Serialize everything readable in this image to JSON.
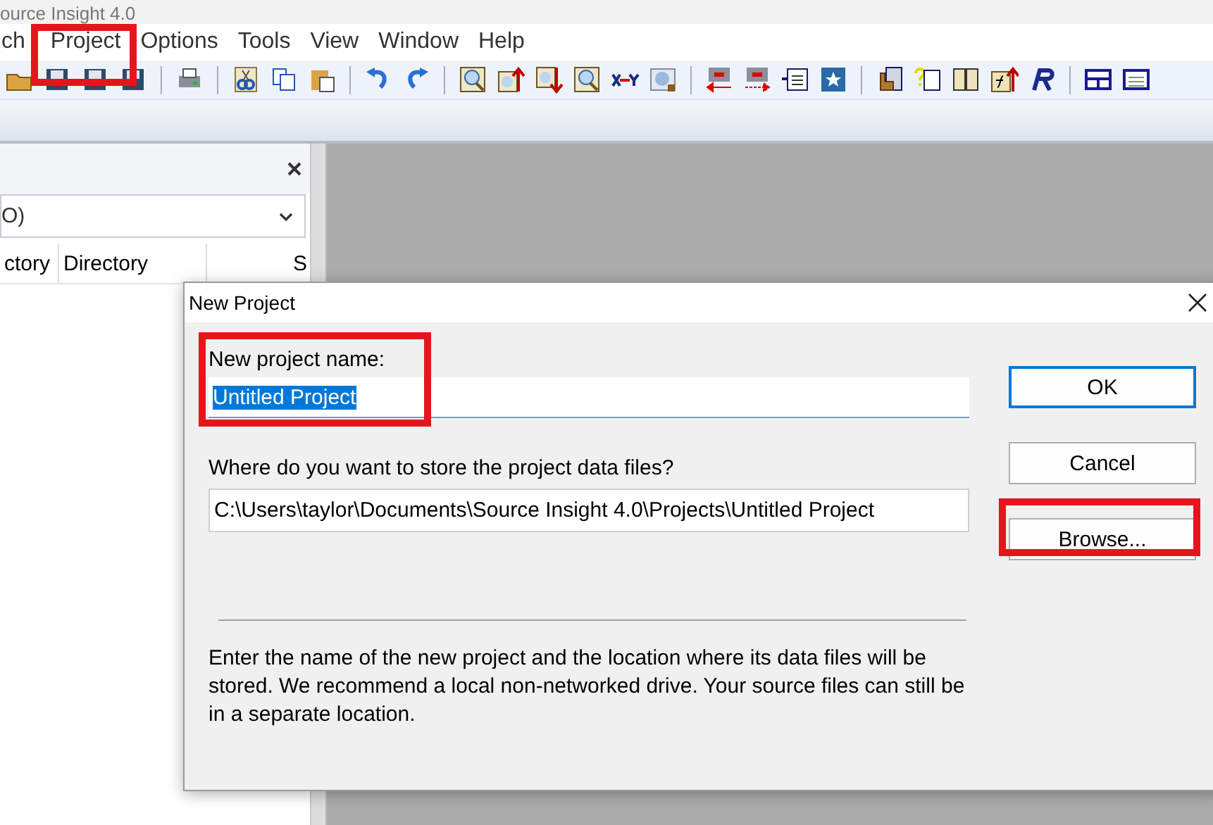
{
  "window": {
    "title": "ource Insight 4.0"
  },
  "menu": [
    {
      "label": "ch"
    },
    {
      "label": "Project"
    },
    {
      "label": "Options"
    },
    {
      "label": "Tools"
    },
    {
      "label": "View"
    },
    {
      "label": "Window"
    },
    {
      "label": "Help"
    }
  ],
  "left_panel": {
    "combo_value": "O)",
    "columns": [
      "ctory",
      "Directory",
      "S"
    ]
  },
  "dialog": {
    "title": "New Project",
    "name_label": "New project name:",
    "name_value": "Untitled Project",
    "name_value_selected": true,
    "location_label": "Where do you want to store the project data files?",
    "location_value": "C:\\Users\\taylor\\Documents\\Source Insight 4.0\\Projects\\Untitled Project",
    "description": "Enter the name of the new project and the location where its data files will be stored. We recommend a local non-networked drive. Your source files can still be in a separate location.",
    "buttons": [
      {
        "label": "OK",
        "default": true
      },
      {
        "label": "Cancel",
        "default": false
      },
      {
        "label": "Browse...",
        "default": false
      }
    ]
  }
}
